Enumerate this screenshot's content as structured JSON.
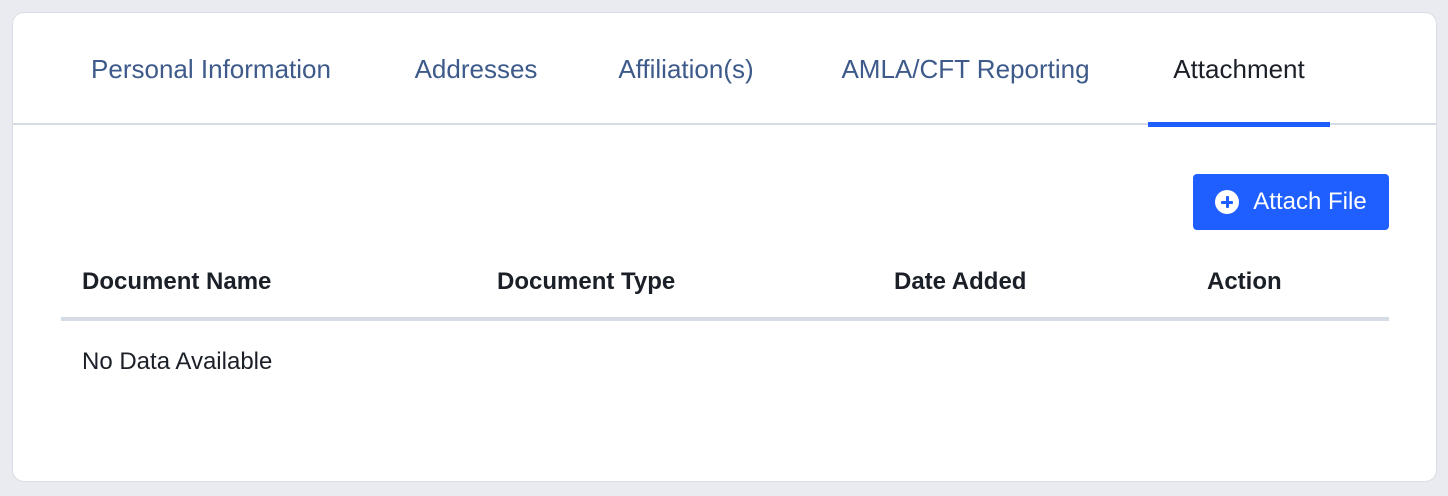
{
  "tabs": [
    {
      "label": "Personal Information",
      "active": false
    },
    {
      "label": "Addresses",
      "active": false
    },
    {
      "label": "Affiliation(s)",
      "active": false
    },
    {
      "label": "AMLA/CFT Reporting",
      "active": false
    },
    {
      "label": "Attachment",
      "active": true
    }
  ],
  "toolbar": {
    "attach_label": "Attach File",
    "attach_icon": "plus-circle-icon"
  },
  "table": {
    "columns": [
      "Document Name",
      "Document Type",
      "Date Added",
      "Action"
    ],
    "rows": [],
    "empty_text": "No Data Available"
  },
  "colors": {
    "accent": "#1f5eff",
    "tab_text": "#3d5a8a",
    "active_tab_text": "#1b1f27",
    "background": "#e9ebf1"
  }
}
